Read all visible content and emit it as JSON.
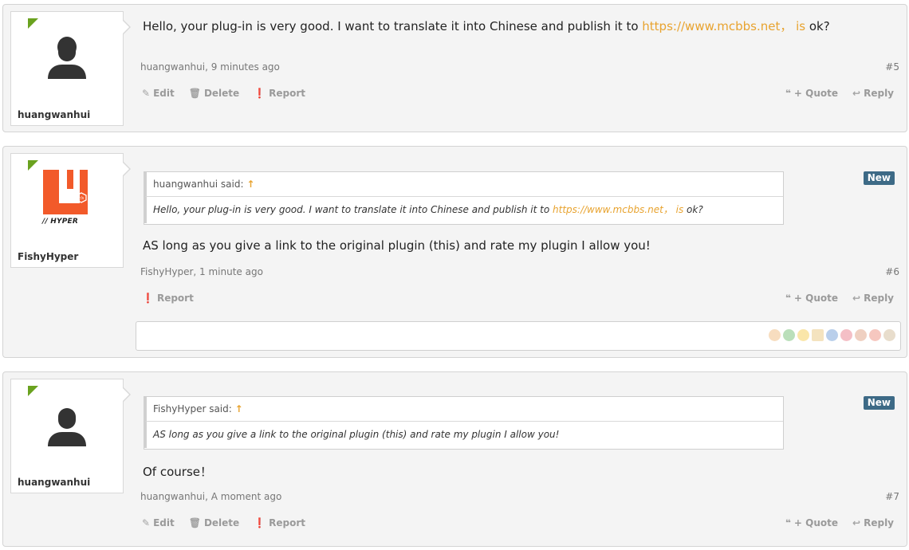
{
  "posts": [
    {
      "author": "huangwanhui",
      "message_prefix": "Hello, your plug-in is very good. I want to translate it into Chinese and publish it to ",
      "message_link": "https://www.mcbbs.net， is",
      "message_suffix": " ok?",
      "meta": "huangwanhui, 9 minutes ago",
      "number": "#5",
      "actions_left": [
        "Edit",
        "Delete",
        "Report"
      ],
      "actions_right": [
        "+ Quote",
        "Reply"
      ]
    },
    {
      "author": "FishyHyper",
      "avatar_text": "// HYPER",
      "badge": "New",
      "quote_head": "huangwanhui said:",
      "quote_arrow": "↑",
      "quote_prefix": "Hello, your plug-in is very good. I want to translate it into Chinese and publish it to ",
      "quote_link": "https://www.mcbbs.net， is",
      "quote_suffix": " ok?",
      "message": "AS long as you give a link to the original plugin (this) and rate my plugin I allow you!",
      "meta": "FishyHyper, 1 minute ago",
      "number": "#6",
      "actions_left": [
        "Report"
      ],
      "actions_right": [
        "+ Quote",
        "Reply"
      ]
    },
    {
      "author": "huangwanhui",
      "badge": "New",
      "quote_head": "FishyHyper said:",
      "quote_arrow": "↑",
      "quote_text": "AS long as you give a link to the original plugin (this) and rate my plugin I allow you!",
      "message": "Of course！",
      "meta": "huangwanhui, A moment ago",
      "number": "#7",
      "actions_left": [
        "Edit",
        "Delete",
        "Report"
      ],
      "actions_right": [
        "+ Quote",
        "Reply"
      ]
    }
  ],
  "icons": {
    "edit": "pencil-icon",
    "delete": "trash-icon",
    "report": "alert-icon",
    "quote": "quote-icon",
    "reply": "reply-icon"
  },
  "colors": {
    "link": "#e8a32f",
    "online": "#6aa21f",
    "badge": "#3d6a86",
    "hyper_logo": "#f25a2a"
  }
}
